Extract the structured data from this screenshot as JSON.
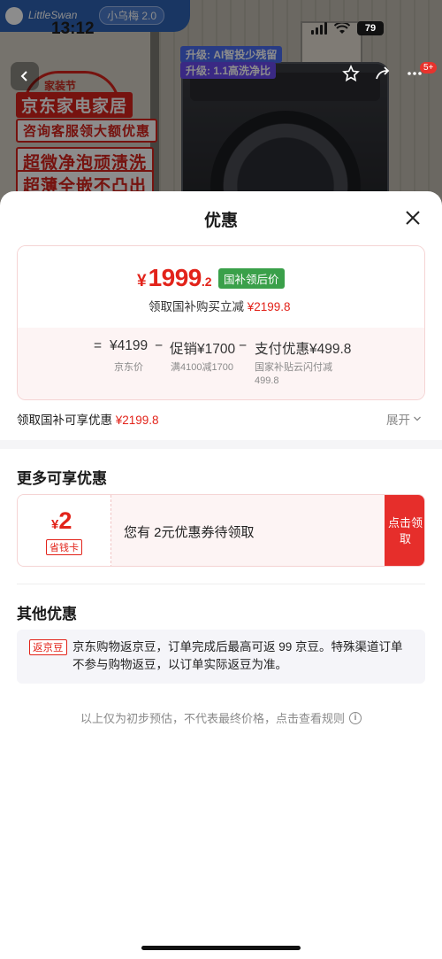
{
  "status_bar": {
    "time": "13:12",
    "battery": "79"
  },
  "background": {
    "brand_name": "LittleSwan",
    "brand_pill": "小乌梅 2.0",
    "promo_tag": "家装节",
    "promo_lines": [
      "京东家电家居",
      "咨询客服领大额优惠",
      "超微净泡顽渍洗",
      "超薄全嵌不凸出"
    ],
    "upgrade_lines": [
      "升级: AI智投少残留",
      "升级: 1.1高洗净比"
    ],
    "nav_badge": "5+"
  },
  "sheet": {
    "title": "优惠",
    "price_card": {
      "currency": "¥",
      "final_int": "1999",
      "final_dec": ".2",
      "badge": "国补领后价",
      "claim_text": "领取国补购买立减",
      "claim_amount": "¥2199.8",
      "calc": {
        "eq": "=",
        "base": "¥4199",
        "minus1": "−",
        "promo": "促销¥1700",
        "minus2": "−",
        "pay": "支付优惠¥499.8",
        "base_sub": "京东价",
        "promo_sub": "满4100减1700",
        "pay_sub": "国家补贴云闪付减 499.8"
      }
    },
    "summary_text": "领取国补可享优惠",
    "summary_amount": "¥2199.8",
    "expand_label": "展开",
    "more_title": "更多可享优惠",
    "coupon": {
      "currency": "¥",
      "amount": "2",
      "type": "省钱卡",
      "text": "您有 2元优惠券待领取",
      "button": "点击领取"
    },
    "other_title": "其他优惠",
    "other": {
      "tag": "返京豆",
      "text": "京东购物返京豆，订单完成后最高可返 99 京豆。特殊渠道订单不参与购物返豆，以订单实际返豆为准。"
    },
    "footnote": "以上仅为初步预估，不代表最终价格，点击查看规则"
  },
  "colors": {
    "accent_red": "#e2231a",
    "badge_green": "#3aa04a",
    "button_red": "#e62e2b"
  }
}
